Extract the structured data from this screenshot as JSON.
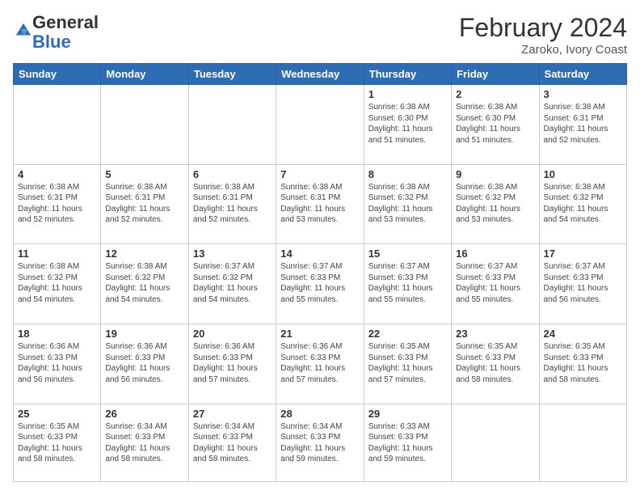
{
  "header": {
    "logo_general": "General",
    "logo_blue": "Blue",
    "month_year": "February 2024",
    "location": "Zaroko, Ivory Coast"
  },
  "days_of_week": [
    "Sunday",
    "Monday",
    "Tuesday",
    "Wednesday",
    "Thursday",
    "Friday",
    "Saturday"
  ],
  "weeks": [
    [
      {
        "day": "",
        "info": ""
      },
      {
        "day": "",
        "info": ""
      },
      {
        "day": "",
        "info": ""
      },
      {
        "day": "",
        "info": ""
      },
      {
        "day": "1",
        "info": "Sunrise: 6:38 AM\nSunset: 6:30 PM\nDaylight: 11 hours\nand 51 minutes."
      },
      {
        "day": "2",
        "info": "Sunrise: 6:38 AM\nSunset: 6:30 PM\nDaylight: 11 hours\nand 51 minutes."
      },
      {
        "day": "3",
        "info": "Sunrise: 6:38 AM\nSunset: 6:31 PM\nDaylight: 11 hours\nand 52 minutes."
      }
    ],
    [
      {
        "day": "4",
        "info": "Sunrise: 6:38 AM\nSunset: 6:31 PM\nDaylight: 11 hours\nand 52 minutes."
      },
      {
        "day": "5",
        "info": "Sunrise: 6:38 AM\nSunset: 6:31 PM\nDaylight: 11 hours\nand 52 minutes."
      },
      {
        "day": "6",
        "info": "Sunrise: 6:38 AM\nSunset: 6:31 PM\nDaylight: 11 hours\nand 52 minutes."
      },
      {
        "day": "7",
        "info": "Sunrise: 6:38 AM\nSunset: 6:31 PM\nDaylight: 11 hours\nand 53 minutes."
      },
      {
        "day": "8",
        "info": "Sunrise: 6:38 AM\nSunset: 6:32 PM\nDaylight: 11 hours\nand 53 minutes."
      },
      {
        "day": "9",
        "info": "Sunrise: 6:38 AM\nSunset: 6:32 PM\nDaylight: 11 hours\nand 53 minutes."
      },
      {
        "day": "10",
        "info": "Sunrise: 6:38 AM\nSunset: 6:32 PM\nDaylight: 11 hours\nand 54 minutes."
      }
    ],
    [
      {
        "day": "11",
        "info": "Sunrise: 6:38 AM\nSunset: 6:32 PM\nDaylight: 11 hours\nand 54 minutes."
      },
      {
        "day": "12",
        "info": "Sunrise: 6:38 AM\nSunset: 6:32 PM\nDaylight: 11 hours\nand 54 minutes."
      },
      {
        "day": "13",
        "info": "Sunrise: 6:37 AM\nSunset: 6:32 PM\nDaylight: 11 hours\nand 54 minutes."
      },
      {
        "day": "14",
        "info": "Sunrise: 6:37 AM\nSunset: 6:33 PM\nDaylight: 11 hours\nand 55 minutes."
      },
      {
        "day": "15",
        "info": "Sunrise: 6:37 AM\nSunset: 6:33 PM\nDaylight: 11 hours\nand 55 minutes."
      },
      {
        "day": "16",
        "info": "Sunrise: 6:37 AM\nSunset: 6:33 PM\nDaylight: 11 hours\nand 55 minutes."
      },
      {
        "day": "17",
        "info": "Sunrise: 6:37 AM\nSunset: 6:33 PM\nDaylight: 11 hours\nand 56 minutes."
      }
    ],
    [
      {
        "day": "18",
        "info": "Sunrise: 6:36 AM\nSunset: 6:33 PM\nDaylight: 11 hours\nand 56 minutes."
      },
      {
        "day": "19",
        "info": "Sunrise: 6:36 AM\nSunset: 6:33 PM\nDaylight: 11 hours\nand 56 minutes."
      },
      {
        "day": "20",
        "info": "Sunrise: 6:36 AM\nSunset: 6:33 PM\nDaylight: 11 hours\nand 57 minutes."
      },
      {
        "day": "21",
        "info": "Sunrise: 6:36 AM\nSunset: 6:33 PM\nDaylight: 11 hours\nand 57 minutes."
      },
      {
        "day": "22",
        "info": "Sunrise: 6:35 AM\nSunset: 6:33 PM\nDaylight: 11 hours\nand 57 minutes."
      },
      {
        "day": "23",
        "info": "Sunrise: 6:35 AM\nSunset: 6:33 PM\nDaylight: 11 hours\nand 58 minutes."
      },
      {
        "day": "24",
        "info": "Sunrise: 6:35 AM\nSunset: 6:33 PM\nDaylight: 11 hours\nand 58 minutes."
      }
    ],
    [
      {
        "day": "25",
        "info": "Sunrise: 6:35 AM\nSunset: 6:33 PM\nDaylight: 11 hours\nand 58 minutes."
      },
      {
        "day": "26",
        "info": "Sunrise: 6:34 AM\nSunset: 6:33 PM\nDaylight: 11 hours\nand 58 minutes."
      },
      {
        "day": "27",
        "info": "Sunrise: 6:34 AM\nSunset: 6:33 PM\nDaylight: 11 hours\nand 58 minutes."
      },
      {
        "day": "28",
        "info": "Sunrise: 6:34 AM\nSunset: 6:33 PM\nDaylight: 11 hours\nand 59 minutes."
      },
      {
        "day": "29",
        "info": "Sunrise: 6:33 AM\nSunset: 6:33 PM\nDaylight: 11 hours\nand 59 minutes."
      },
      {
        "day": "",
        "info": ""
      },
      {
        "day": "",
        "info": ""
      }
    ]
  ]
}
